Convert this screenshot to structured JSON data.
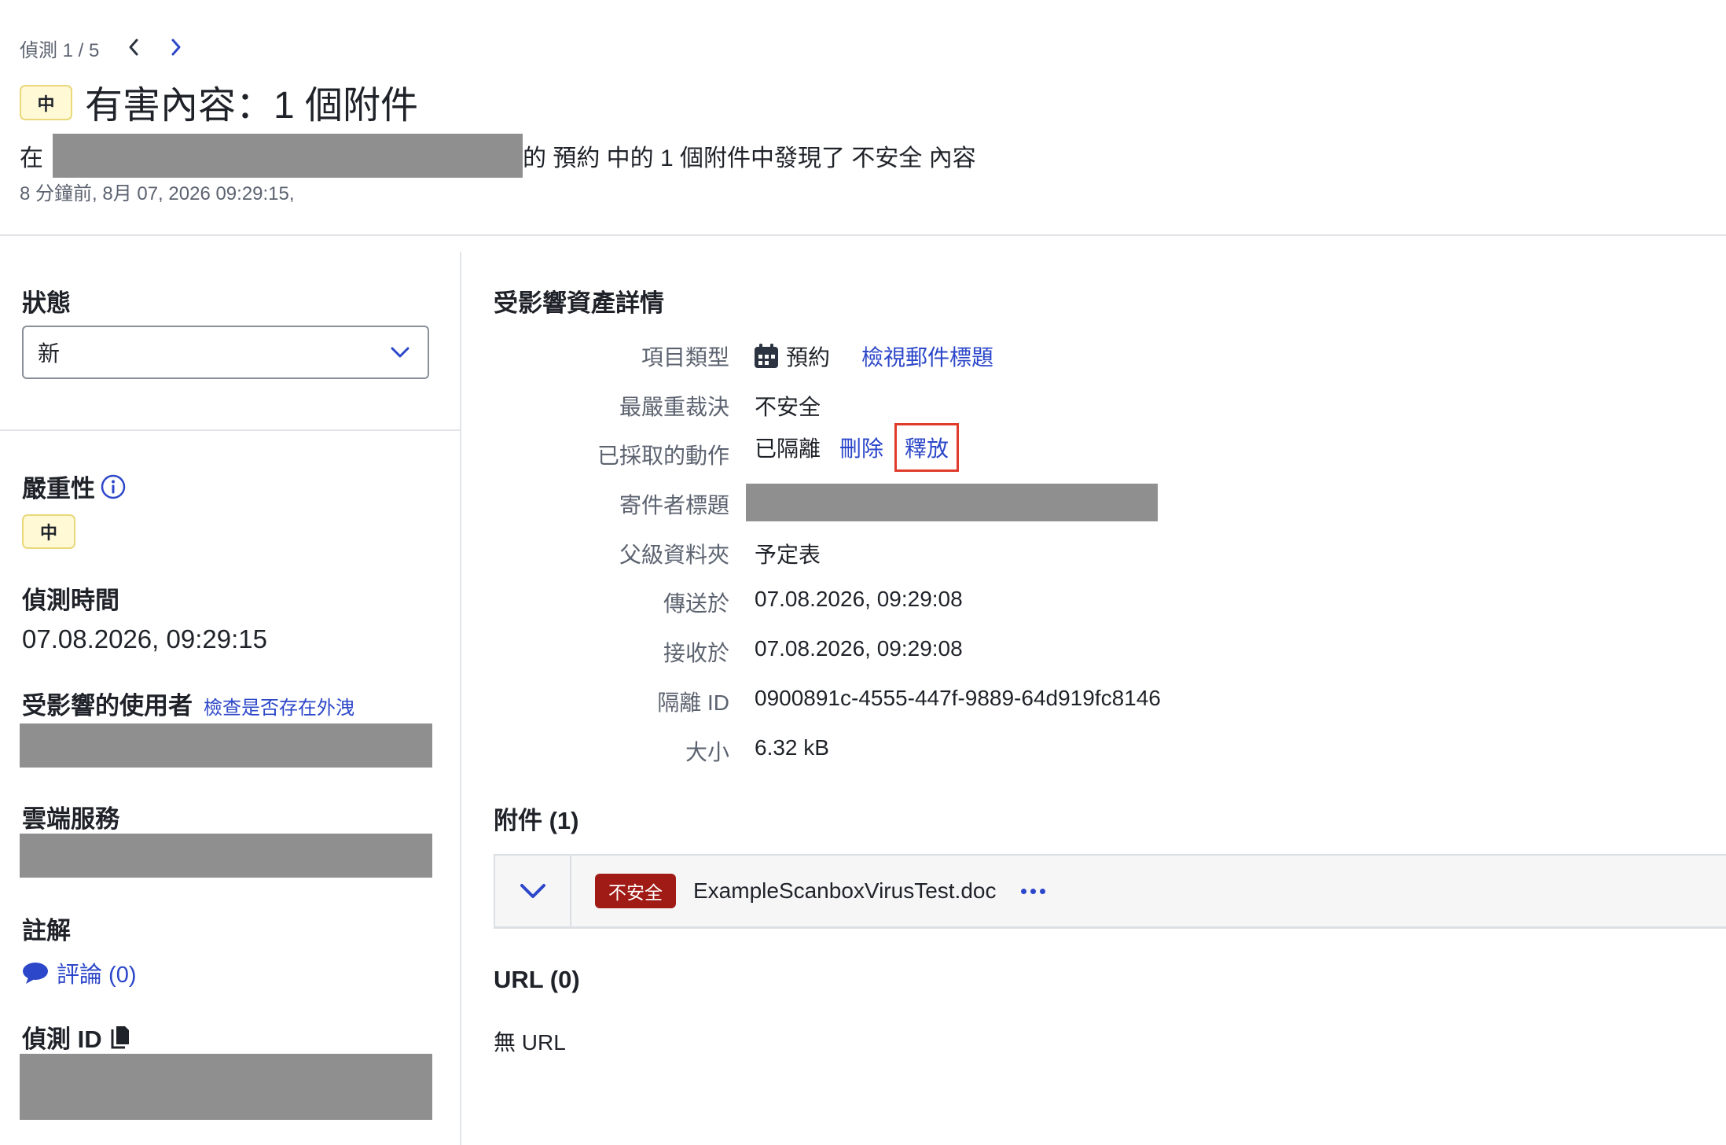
{
  "nav": {
    "counter": "偵測 1 / 5"
  },
  "header": {
    "severity": "中",
    "title": "有害內容：1 個附件",
    "desc_prefix": "在",
    "desc_suffix": "的 預約 中的 1 個附件中發現了 不安全 內容",
    "timestamp": "8 分鐘前, 8月 07, 2026 09:29:15,"
  },
  "left": {
    "status_label": "狀態",
    "status_value": "新",
    "severity_label": "嚴重性",
    "severity_value": "中",
    "detection_time_label": "偵測時間",
    "detection_time_value": "07.08.2026, 09:29:15",
    "affected_user_label": "受影響的使用者",
    "leak_check_link": "檢查是否存在外洩",
    "cloud_service_label": "雲端服務",
    "notes_label": "註解",
    "comments_link": "評論 (0)",
    "detection_id_label": "偵測 ID"
  },
  "asset": {
    "section_title": "受影響資產詳情",
    "item_type_label": "項目類型",
    "item_type_value": "預約",
    "view_headers_link": "檢視郵件標題",
    "verdict_label": "最嚴重裁決",
    "verdict_value": "不安全",
    "action_label": "已採取的動作",
    "action_value": "已隔離",
    "delete_link": "刪除",
    "release_link": "釋放",
    "sender_label": "寄件者標題",
    "folder_label": "父級資料夾",
    "folder_value": "予定表",
    "sent_label": "傳送於",
    "sent_value": "07.08.2026, 09:29:08",
    "received_label": "接收於",
    "received_value": "07.08.2026, 09:29:08",
    "quarantine_label": "隔離 ID",
    "quarantine_value": "0900891c-4555-447f-9889-64d919fc8146",
    "size_label": "大小",
    "size_value": "6.32 kB"
  },
  "attachments": {
    "title": "附件 (1)",
    "items": [
      {
        "verdict": "不安全",
        "name": "ExampleScanboxVirusTest.doc"
      }
    ]
  },
  "urls": {
    "title": "URL (0)",
    "empty_text": "無 URL"
  },
  "colors": {
    "link": "#2c47c9",
    "unsafe": "#a01b15",
    "highlight": "#e03c2c",
    "severity_bg": "#fff9d6"
  }
}
